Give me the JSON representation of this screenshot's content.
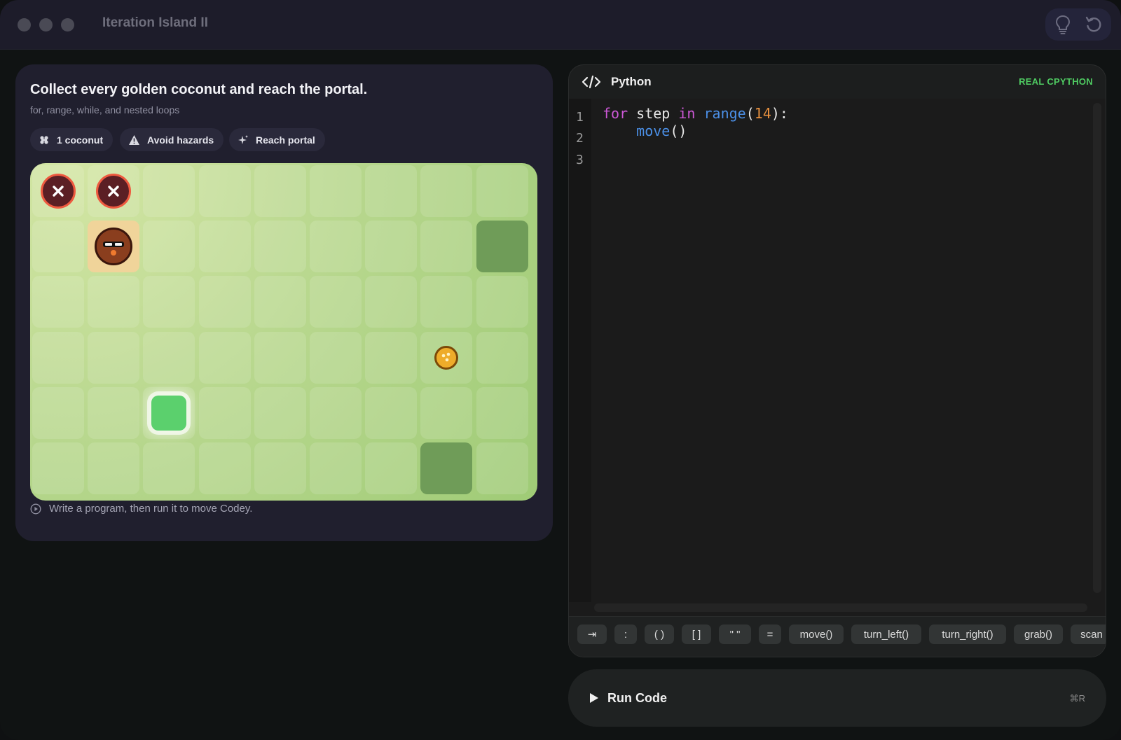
{
  "window": {
    "title": "Iteration Island II"
  },
  "toolbar": {
    "hint_icon": "lightbulb-icon",
    "reset_icon": "reset-icon"
  },
  "level": {
    "title": "Collect every golden coconut and reach the portal.",
    "subtitle": "for, range, while, and nested loops",
    "chips": [
      {
        "label": "1 coconut",
        "icon": "coconut-icon"
      },
      {
        "label": "Avoid hazards",
        "icon": "warning-icon"
      },
      {
        "label": "Reach portal",
        "icon": "sparkle-icon"
      }
    ],
    "status": "Write a program, then run it to move Codey."
  },
  "board": {
    "cols": 9,
    "rows": 6,
    "hazards": [
      {
        "col": 0,
        "row": 0
      },
      {
        "col": 1,
        "row": 0
      }
    ],
    "player": {
      "col": 1,
      "row": 1
    },
    "coconut": {
      "col": 7,
      "row": 3
    },
    "portal": {
      "col": 2,
      "row": 4
    },
    "blocked": [
      {
        "col": 8,
        "row": 1
      },
      {
        "col": 7,
        "row": 5
      }
    ]
  },
  "editor": {
    "language": "Python",
    "badge": "REAL CPYTHON",
    "line_numbers": [
      "1",
      "2",
      "3"
    ],
    "code": {
      "l1_kw": "for",
      "l1_var": " step ",
      "l1_in": "in",
      "l1_sp": " ",
      "l1_fn": "range",
      "l1_open": "(",
      "l1_num": "14",
      "l1_close": "):",
      "l2_indent": "    ",
      "l2_fn": "move",
      "l2_paren": "()"
    },
    "keys": [
      "⇥",
      ":",
      "( )",
      "[ ]",
      "\" \"",
      "=",
      "move()",
      "turn_left()",
      "turn_right()",
      "grab()",
      "scan"
    ]
  },
  "run": {
    "label": "Run Code",
    "shortcut": "⌘R"
  },
  "colors": {
    "accent_green": "#4fcc62",
    "hazard_red": "#ee5a3f",
    "coconut_gold": "#eeac2a",
    "portal_green": "#5bd06d"
  }
}
